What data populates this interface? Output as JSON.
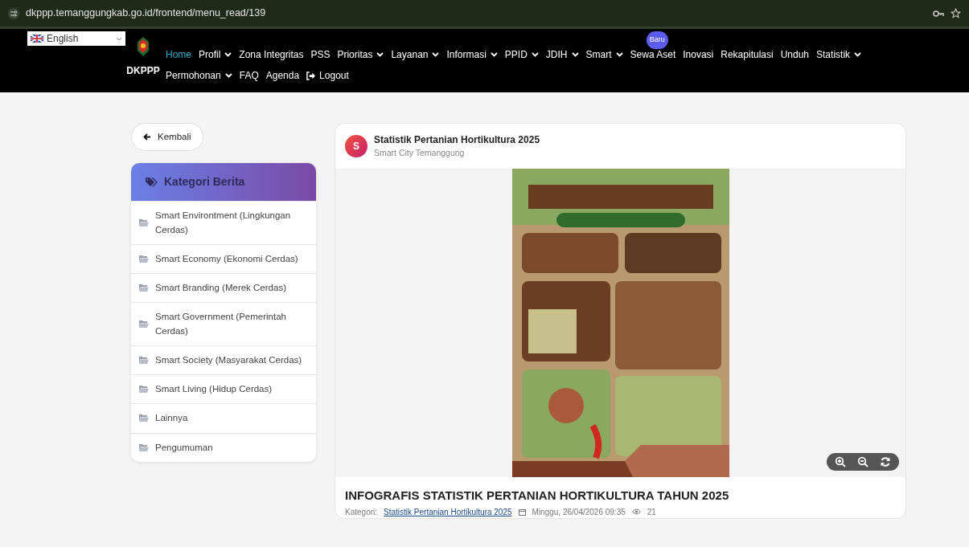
{
  "browser": {
    "url": "dkppp.temanggungkab.go.id/frontend/menu_read/139"
  },
  "language": {
    "value": "English"
  },
  "logo": {
    "text": "DKPPP"
  },
  "nav": [
    {
      "label": "Home",
      "selected": true,
      "dropdown": false
    },
    {
      "label": "Profil",
      "selected": false,
      "dropdown": true
    },
    {
      "label": "Zona Integritas",
      "selected": false,
      "dropdown": false
    },
    {
      "label": "PSS",
      "selected": false,
      "dropdown": false
    },
    {
      "label": "Prioritas",
      "selected": false,
      "dropdown": true
    },
    {
      "label": "Layanan",
      "selected": false,
      "dropdown": true
    },
    {
      "label": "Informasi",
      "selected": false,
      "dropdown": true
    },
    {
      "label": "PPID",
      "selected": false,
      "dropdown": true
    },
    {
      "label": "JDIH",
      "selected": false,
      "dropdown": true
    },
    {
      "label": "Smart",
      "selected": false,
      "dropdown": true
    },
    {
      "label": "Sewa Aset",
      "selected": false,
      "dropdown": false,
      "badge": "Baru"
    },
    {
      "label": "Inovasi",
      "selected": false,
      "dropdown": false
    },
    {
      "label": "Rekapitulasi",
      "selected": false,
      "dropdown": false
    },
    {
      "label": "Unduh",
      "selected": false,
      "dropdown": false
    },
    {
      "label": "Statistik",
      "selected": false,
      "dropdown": true
    },
    {
      "label": "Permohonan",
      "selected": false,
      "dropdown": true
    },
    {
      "label": "FAQ",
      "selected": false,
      "dropdown": false
    },
    {
      "label": "Agenda",
      "selected": false,
      "dropdown": false
    },
    {
      "label": "Logout",
      "selected": false,
      "dropdown": false,
      "kind": "logout"
    }
  ],
  "back_button": "Kembali",
  "sidebar": {
    "title": "Kategori Berita",
    "items": [
      "Smart Environtment (Lingkungan Cerdas)",
      "Smart Economy (Ekonomi Cerdas)",
      "Smart Branding (Merek Cerdas)",
      "Smart Government (Pemerintah Cerdas)",
      "Smart Society (Masyarakat Cerdas)",
      "Smart Living (Hidup Cerdas)",
      "Lainnya",
      "Pengumuman"
    ]
  },
  "post": {
    "avatar": "S",
    "title": "Statistik Pertanian Hortikultura 2025",
    "author": "Smart City Temanggung",
    "heading": "INFOGRAFIS STATISTIK PERTANIAN HORTIKULTURA TAHUN 2025",
    "meta": {
      "label": "Kategori:",
      "category": "Statistik Pertanian Hortikultura 2025",
      "date": "Minggu, 26/04/2026 09:35",
      "views": "21"
    }
  }
}
